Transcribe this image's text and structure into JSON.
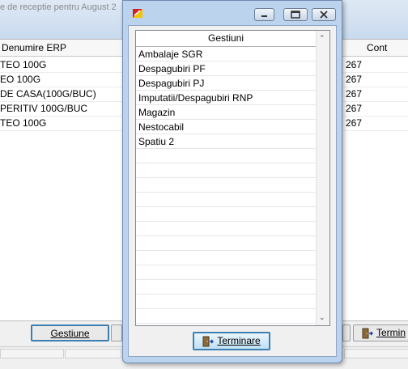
{
  "background": {
    "title": "e de receptie  pentru August 2",
    "grid": {
      "columns": [
        "Denumire ERP",
        "Cont"
      ],
      "rows": [
        {
          "name": "TEO 100G",
          "cont": "267"
        },
        {
          "name": "EO 100G",
          "cont": "267"
        },
        {
          "name": "DE CASA(100G/BUC)",
          "cont": "267"
        },
        {
          "name": "PERITIV 100G/BUC",
          "cont": "267"
        },
        {
          "name": "TEO 100G",
          "cont": "267"
        }
      ]
    },
    "buttons": {
      "gestiune": "Gestiune",
      "terminare": "Termin"
    }
  },
  "dialog": {
    "list_header": "Gestiuni",
    "items": [
      "Ambalaje SGR",
      "Despagubiri PF",
      "Despagubiri PJ",
      "Imputatii/Despagubiri RNP",
      "Magazin",
      "Nestocabil",
      "Spatiu 2"
    ],
    "terminare_label": "Terminare"
  },
  "colors": {
    "accent": "#3c7fb1",
    "dialog_frame": "#bcd3ee",
    "app_icon_red": "#d42020",
    "app_icon_yellow": "#f5c400"
  }
}
